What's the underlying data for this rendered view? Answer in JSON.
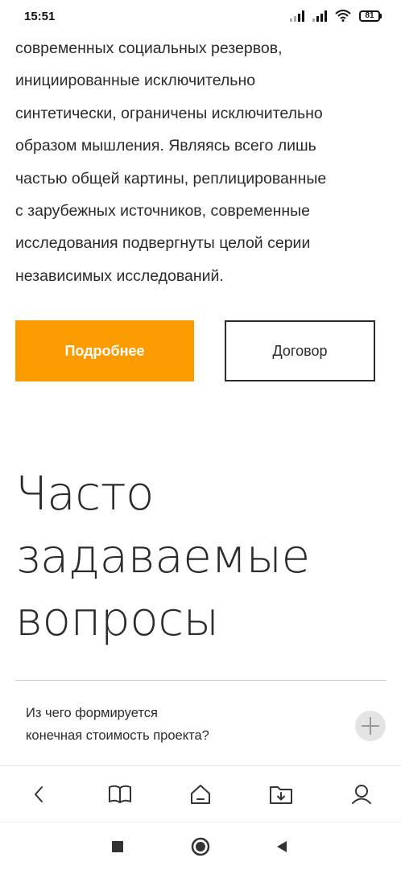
{
  "status_bar": {
    "time": "15:51",
    "battery": "81",
    "icons": [
      "signal-icon",
      "signal-icon",
      "wifi-icon",
      "battery-icon"
    ]
  },
  "article": {
    "lines": [
      "современных социальных резервов,",
      "инициированные исключительно",
      "синтетически, ограничены исключительно",
      "образом мышления. Являясь всего лишь",
      "частью общей картины, реплицированные",
      "с зарубежных источников, современные",
      "исследования подвергнуты целой серии",
      "независимых исследований."
    ]
  },
  "buttons": {
    "details": "Подробнее",
    "contract": "Договор"
  },
  "colors": {
    "accent": "#fa9c00",
    "text": "#2b2b2b"
  },
  "faq": {
    "title_lines": [
      "Часто",
      "задаваемые",
      "вопросы"
    ],
    "items": [
      {
        "question_lines": [
          "Из чего формируется",
          "конечная стоимость проекта?"
        ]
      }
    ]
  },
  "browser_toolbar": {
    "icons": [
      "back-icon",
      "book-icon",
      "home-icon",
      "download-folder-icon",
      "profile-icon"
    ]
  },
  "system_nav": {
    "icons": [
      "recents-icon",
      "home-circle-icon",
      "back-triangle-icon"
    ]
  }
}
